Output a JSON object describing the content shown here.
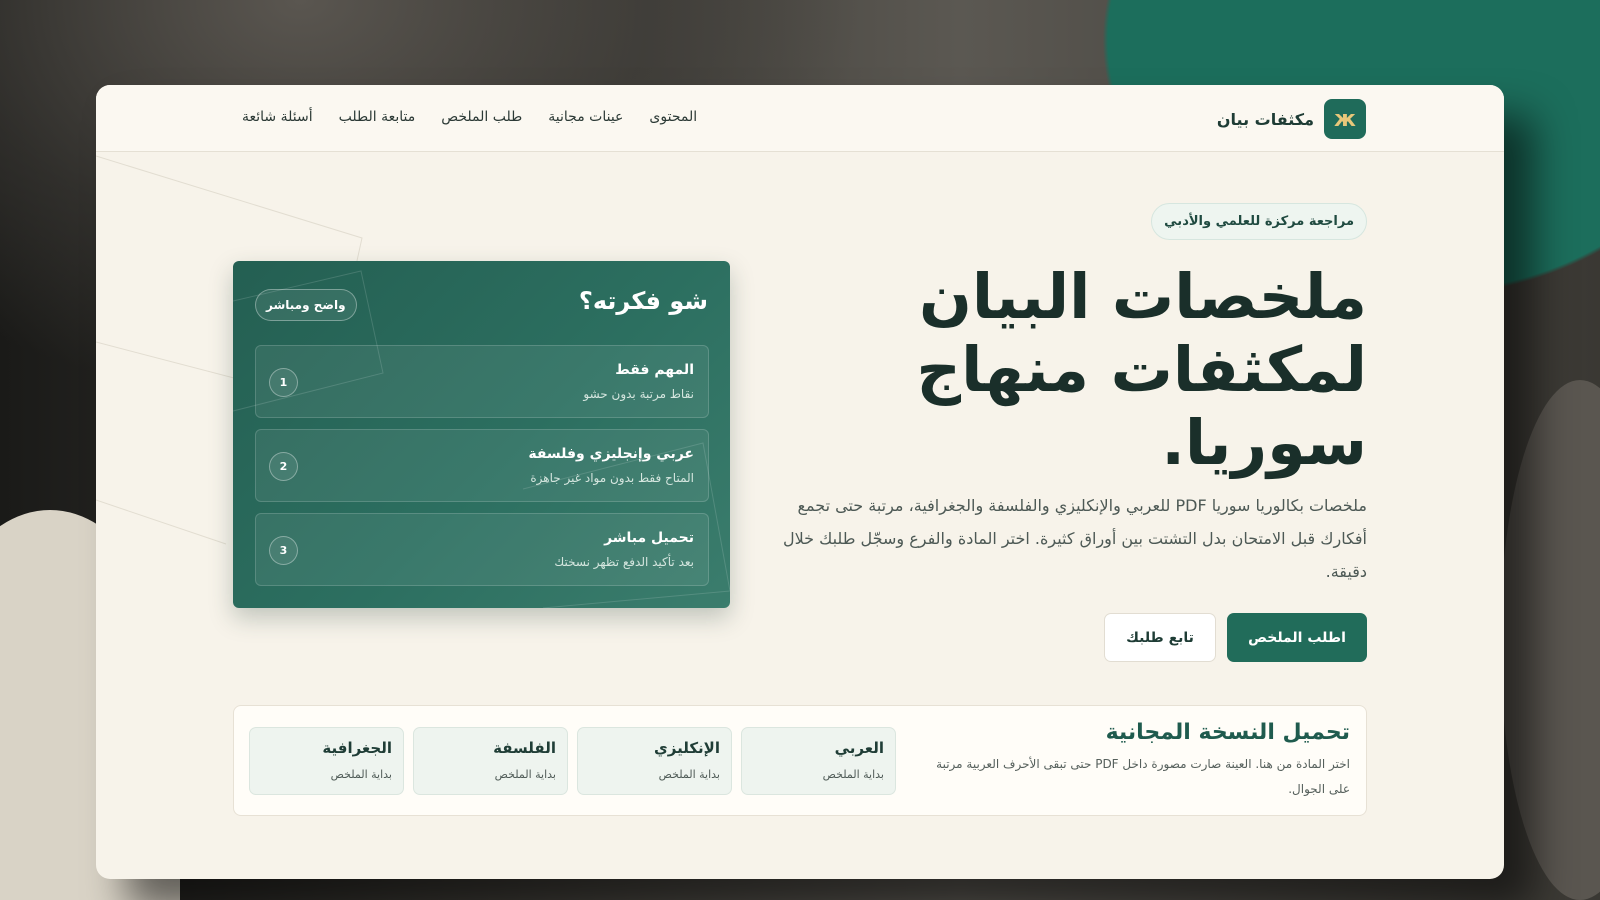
{
  "brand": {
    "name": "مكثفات بيان",
    "logo_glyph": "ж"
  },
  "nav": [
    "المحتوى",
    "عينات مجانية",
    "طلب الملخص",
    "متابعة الطلب",
    "أسئلة شائعة"
  ],
  "hero": {
    "badge": "مراجعة مركزة للعلمي والأدبي",
    "title_lines": [
      "ملخصات البيان",
      "لمكثفات منهاج",
      "سوريا."
    ],
    "description": "ملخصات بكالوريا سوريا PDF للعربي والإنكليزي والفلسفة والجغرافية، مرتبة حتى تجمع أفكارك قبل الامتحان بدل التشتت بين أوراق كثيرة. اختر المادة والفرع وسجّل طلبك خلال دقيقة.",
    "primary_button": "اطلب الملخص",
    "secondary_button": "تابع طلبك"
  },
  "idea_card": {
    "title": "شو فكرته؟",
    "tag": "واضح ومباشر",
    "items": [
      {
        "num": "1",
        "title": "المهم فقط",
        "subtitle": "نقاط مرتبة بدون حشو"
      },
      {
        "num": "2",
        "title": "عربي وإنجليزي وفلسفة",
        "subtitle": "المتاح فقط بدون مواد غير جاهزة"
      },
      {
        "num": "3",
        "title": "تحميل مباشر",
        "subtitle": "بعد تأكيد الدفع تظهر نسختك"
      }
    ]
  },
  "download": {
    "title": "تحميل النسخة المجانية",
    "description": "اختر المادة من هنا. العينة صارت مصورة داخل PDF حتى تبقى الأحرف العربية مرتبة على الجوال.",
    "subjects": [
      {
        "name": "العربي",
        "subtitle": "بداية الملخص"
      },
      {
        "name": "الإنكليزي",
        "subtitle": "بداية الملخص"
      },
      {
        "name": "الفلسفة",
        "subtitle": "بداية الملخص"
      },
      {
        "name": "الجغرافية",
        "subtitle": "بداية الملخص"
      }
    ]
  },
  "colors": {
    "accent": "#216c5a",
    "card_bg": "#2c6f60",
    "page_bg": "#f7f3ea",
    "logo_gold": "#e8c77a"
  }
}
